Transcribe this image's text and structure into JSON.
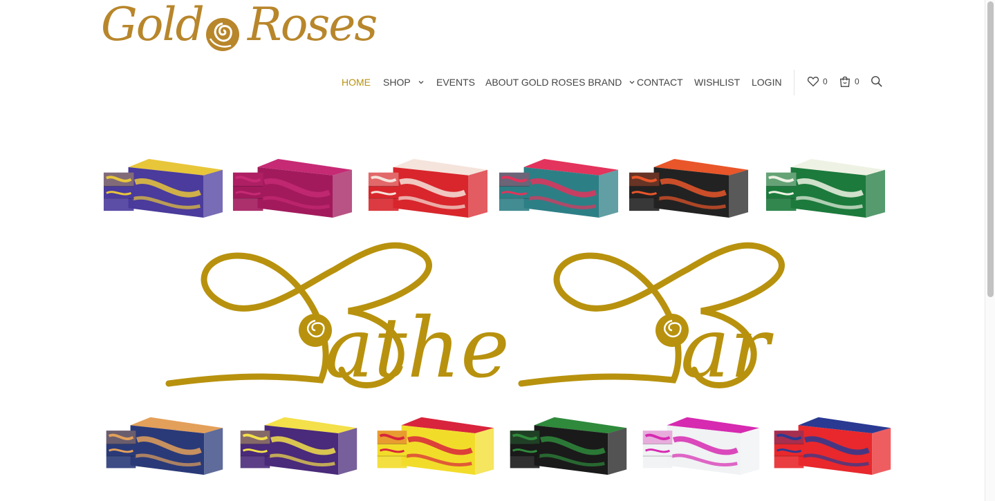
{
  "brand": {
    "logo_word_1": "Gold",
    "logo_word_2": "Roses",
    "logo_color": "#b8862b"
  },
  "nav": {
    "items": [
      {
        "label": "HOME",
        "active": true,
        "has_dropdown": false
      },
      {
        "label": "SHOP",
        "active": false,
        "has_dropdown": true
      },
      {
        "label": "EVENTS",
        "active": false,
        "has_dropdown": false
      },
      {
        "label": "ABOUT GOLD ROSES BRAND",
        "active": false,
        "has_dropdown": true
      },
      {
        "label": "CONTACT",
        "active": false,
        "has_dropdown": false
      },
      {
        "label": "WISHLIST",
        "active": false,
        "has_dropdown": false
      },
      {
        "label": "LOGIN",
        "active": false,
        "has_dropdown": false
      }
    ],
    "wishlist_count": "0",
    "cart_count": "0",
    "active_color": "#b8920e",
    "text_color": "#444444",
    "icons": [
      "heart-icon",
      "shopping-bag-icon",
      "search-icon"
    ]
  },
  "banner": {
    "word_1": "Bathe",
    "word_2": "Bar",
    "text_color": "#b8920e",
    "top_row_soaps": [
      {
        "name": "purple-yellow-swirl-soap",
        "base": "#4a3b9c",
        "accent": "#e8c63a"
      },
      {
        "name": "magenta-soap",
        "base": "#a21a5c",
        "accent": "#c62a74"
      },
      {
        "name": "red-white-swirl-soap",
        "base": "#d8262c",
        "accent": "#f5e4dc"
      },
      {
        "name": "teal-pink-soap",
        "base": "#2d7f86",
        "accent": "#e2345c"
      },
      {
        "name": "black-orange-swirl-soap",
        "base": "#222222",
        "accent": "#e8562a"
      },
      {
        "name": "white-green-soap",
        "base": "#1c7a3c",
        "accent": "#eef2e4"
      }
    ],
    "bottom_row_soaps": [
      {
        "name": "navy-orange-soap",
        "base": "#2a3a78",
        "accent": "#e3a05a"
      },
      {
        "name": "purple-yellow-soap",
        "base": "#4a2a7a",
        "accent": "#f3e04a"
      },
      {
        "name": "yellow-red-swirl-soap",
        "base": "#f2dc2a",
        "accent": "#d8243c"
      },
      {
        "name": "black-green-soap",
        "base": "#1a1a1a",
        "accent": "#2f8a3c"
      },
      {
        "name": "white-speckled-soap",
        "base": "#f0f2f4",
        "accent": "#d62ab0"
      },
      {
        "name": "red-blue-yellow-soap",
        "base": "#e8282c",
        "accent": "#2a3a92"
      }
    ]
  }
}
